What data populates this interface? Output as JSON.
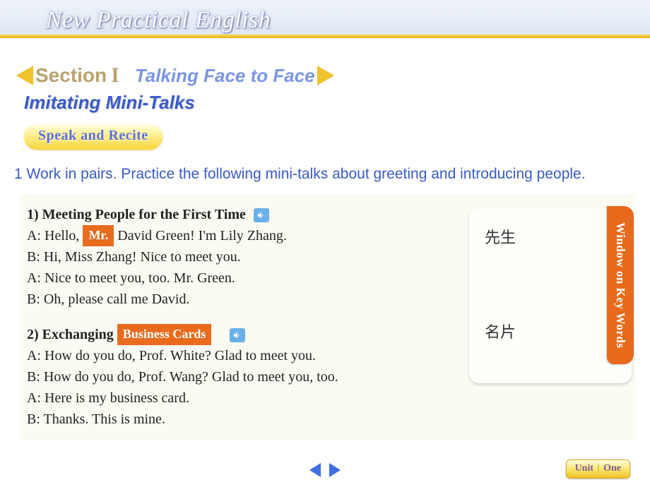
{
  "header": {
    "title": "New Practical English"
  },
  "section": {
    "label": "Section",
    "number": "I",
    "subtitle": "Talking Face to Face"
  },
  "subheading": "Imitating Mini-Talks",
  "badge": "Speak  and  Recite",
  "instruction": "1 Work in pairs. Practice the following mini-talks about greeting and introducing people.",
  "dialogue1": {
    "title_prefix": "1) Meeting People for the First Time",
    "line1_pre": "A: Hello,",
    "tag1": "Mr.",
    "line1_post": "  David Green! I'm Lily Zhang.",
    "line2": "B: Hi, Miss Zhang! Nice to meet you.",
    "line3": "A: Nice to meet you, too. Mr. Green.",
    "line4": "B: Oh, please call me David."
  },
  "dialogue2": {
    "title_prefix": "2) Exchanging",
    "tag2": "Business Cards",
    "line1": "A: How do you do, Prof. White? Glad to meet you.",
    "line2": "B: How do you do, Prof. Wang? Glad to meet you, too.",
    "line3": "A: Here is my business card.",
    "line4": "B: Thanks. This is mine."
  },
  "keywords": {
    "kw1": "先生",
    "kw2": "名片"
  },
  "window_label": "Window on Key Words",
  "unit": {
    "label": "Unit",
    "sep": "|",
    "name": "One"
  }
}
